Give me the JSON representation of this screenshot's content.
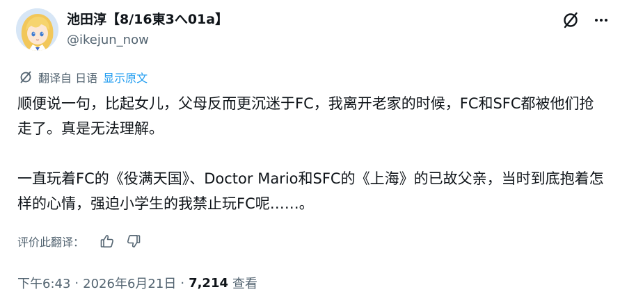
{
  "author": {
    "display_name": "池田淳【8/16東3へ01a】",
    "handle": "@ikejun_now"
  },
  "header_icons": {
    "grok": "grok-icon",
    "more": "more-icon"
  },
  "translation": {
    "translated_from": "翻译自 日语",
    "show_original_label": "显示原文",
    "rate_label": "评价此翻译："
  },
  "tweet": {
    "paragraphs": [
      "顺便说一句，比起女儿，父母反而更沉迷于FC，我离开老家的时候，FC和SFC都被他们抢走了。真是无法理解。",
      "一直玩着FC的《役满天国》、Doctor Mario和SFC的《上海》的已故父亲，当时到底抱着怎样的心情，强迫小学生的我禁止玩FC呢……。"
    ]
  },
  "meta": {
    "time": "下午6:43",
    "separator": "·",
    "date": "2026年6月21日",
    "views_count": "7,214",
    "views_label": "查看"
  },
  "colors": {
    "text_primary": "#0f1419",
    "text_secondary": "#536471",
    "link": "#1d9bf0"
  }
}
